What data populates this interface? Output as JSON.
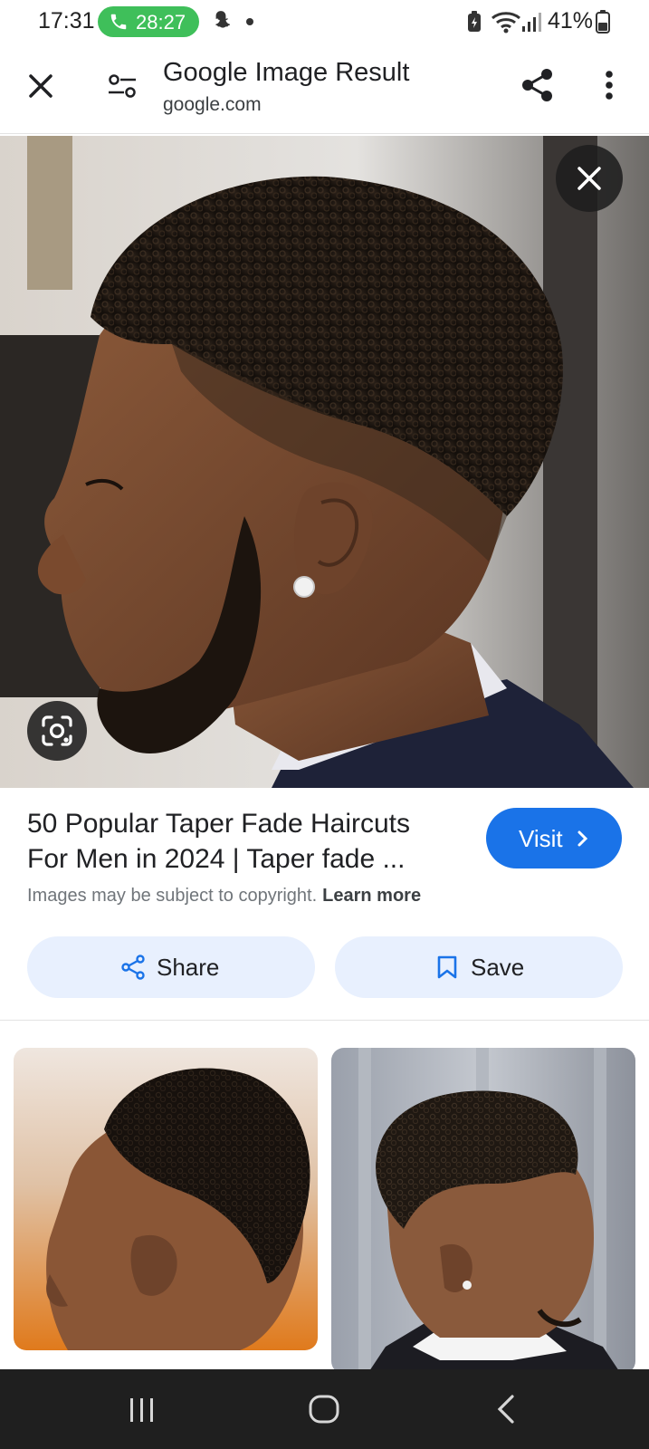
{
  "status_bar": {
    "time": "17:31",
    "call_duration": "28:27",
    "battery": "41%",
    "icons": [
      "phone-icon",
      "snapchat-icon",
      "notification-dot",
      "battery-saver-icon",
      "wifi-icon",
      "signal-icon",
      "battery-icon"
    ]
  },
  "app_bar": {
    "title": "Google Image Result",
    "domain": "google.com",
    "icons": [
      "close-icon",
      "tune-icon",
      "share-icon",
      "more-vert-icon"
    ]
  },
  "result": {
    "title": "50 Popular Taper Fade Haircuts For Men in 2024 | Taper fade ...",
    "visit_label": "Visit",
    "copyright_text": "Images may be subject to copyright.",
    "learn_more": "Learn more"
  },
  "actions": {
    "share_label": "Share",
    "save_label": "Save"
  },
  "colors": {
    "accent": "#1a73e8",
    "pill_bg": "#e8f0fe",
    "call_green": "#3fbf5a",
    "nav_bg": "#1f1f1f"
  }
}
